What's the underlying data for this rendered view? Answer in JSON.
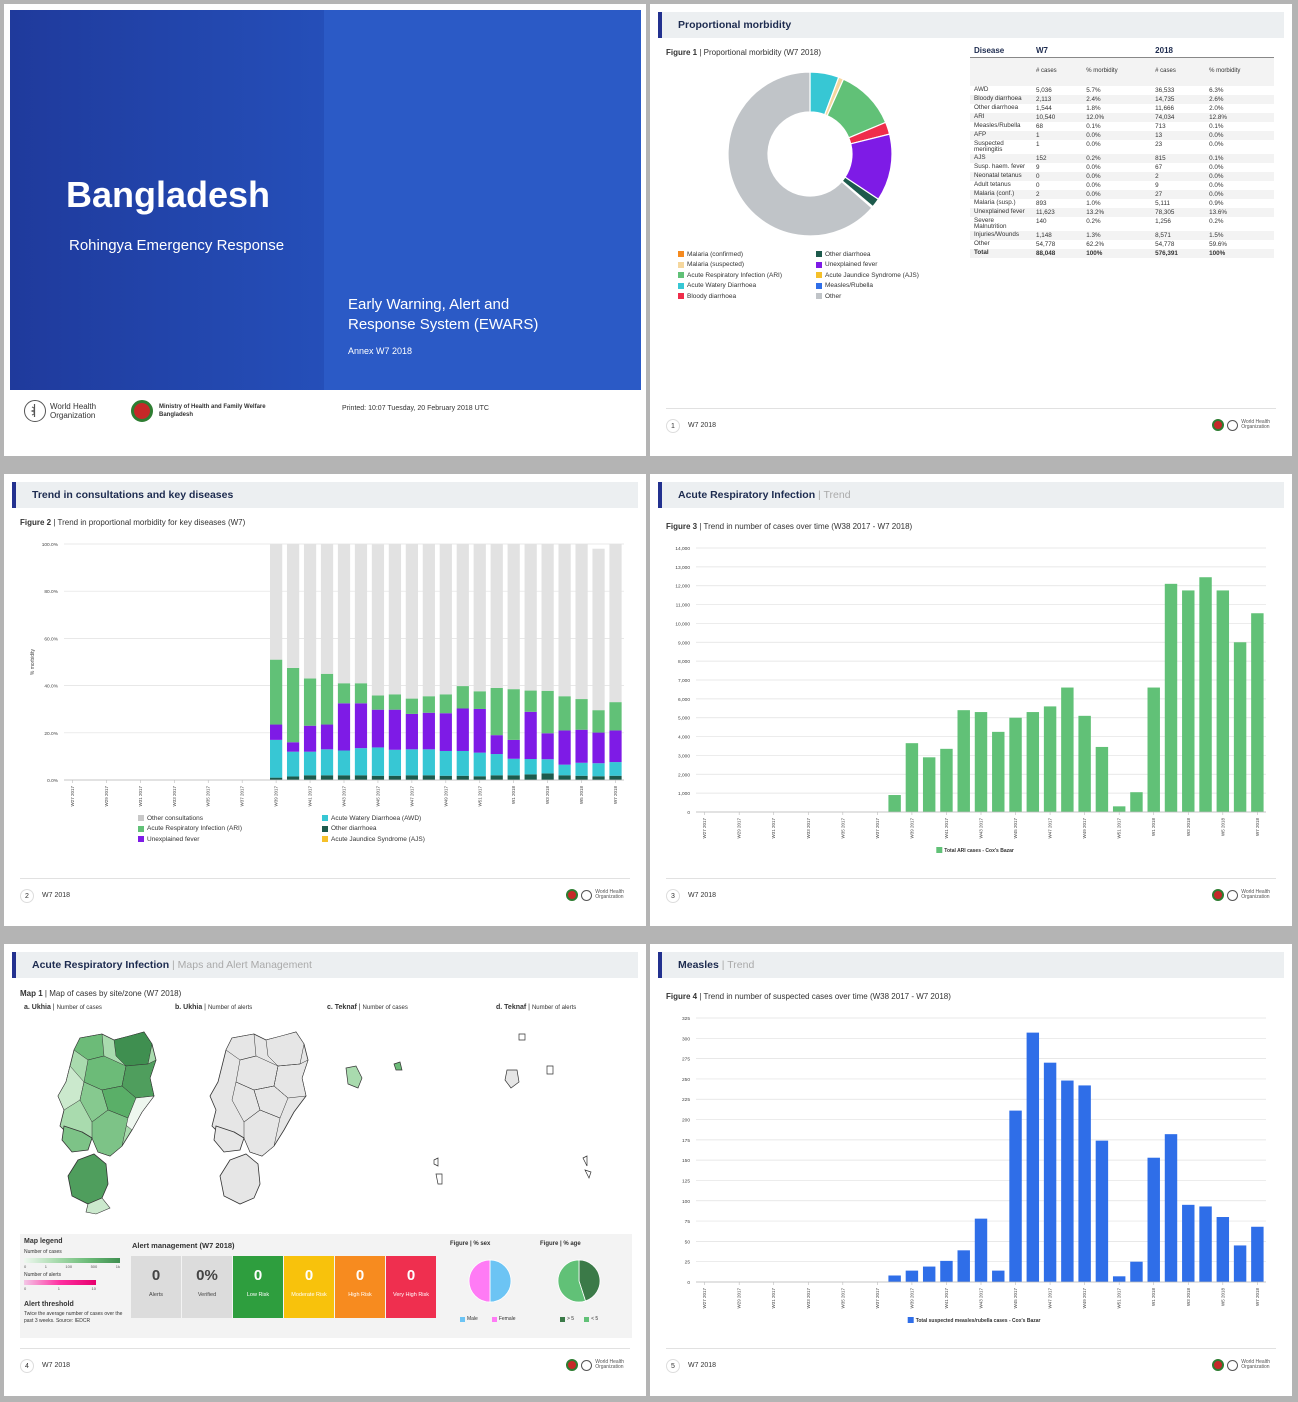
{
  "cover": {
    "country": "Bangladesh",
    "subtitle": "Rohingya Emergency Response",
    "system_line1": "Early Warning, Alert and",
    "system_line2": "Response System (EWARS)",
    "annex": "Annex W7 2018",
    "who_line1": "World Health",
    "who_line2": "Organization",
    "ministry_line1": "Ministry of Health and Family Welfare",
    "ministry_line2": "Bangladesh",
    "printed": "Printed: 10:07 Tuesday, 20 February 2018 UTC"
  },
  "footer": {
    "week": "W7 2018",
    "who_line1": "World Health",
    "who_line2": "Organization"
  },
  "page1": {
    "number": "1",
    "header": "Proportional morbidity",
    "fig_label": "Figure 1",
    "fig_caption": "Proportional morbidity (W7 2018)",
    "table": {
      "col_disease": "Disease",
      "col_w7": "W7",
      "col_2018": "2018",
      "sub_cases": "# cases",
      "sub_pct": "% morbidity",
      "rows": [
        [
          "AWD",
          "5,036",
          "5.7%",
          "36,533",
          "6.3%"
        ],
        [
          "Bloody diarrhoea",
          "2,113",
          "2.4%",
          "14,735",
          "2.6%"
        ],
        [
          "Other diarrhoea",
          "1,544",
          "1.8%",
          "11,666",
          "2.0%"
        ],
        [
          "ARI",
          "10,540",
          "12.0%",
          "74,034",
          "12.8%"
        ],
        [
          "Measles/Rubella",
          "68",
          "0.1%",
          "713",
          "0.1%"
        ],
        [
          "AFP",
          "1",
          "0.0%",
          "13",
          "0.0%"
        ],
        [
          "Suspected meningitis",
          "1",
          "0.0%",
          "23",
          "0.0%"
        ],
        [
          "AJS",
          "152",
          "0.2%",
          "815",
          "0.1%"
        ],
        [
          "Susp. haem. fever",
          "9",
          "0.0%",
          "67",
          "0.0%"
        ],
        [
          "Neonatal tetanus",
          "0",
          "0.0%",
          "2",
          "0.0%"
        ],
        [
          "Adult tetanus",
          "0",
          "0.0%",
          "9",
          "0.0%"
        ],
        [
          "Malaria (conf.)",
          "2",
          "0.0%",
          "27",
          "0.0%"
        ],
        [
          "Malaria (susp.)",
          "893",
          "1.0%",
          "5,111",
          "0.9%"
        ],
        [
          "Unexplained fever",
          "11,623",
          "13.2%",
          "78,305",
          "13.6%"
        ],
        [
          "Severe Malnutrition",
          "140",
          "0.2%",
          "1,256",
          "0.2%"
        ],
        [
          "Injuries/Wounds",
          "1,148",
          "1.3%",
          "8,571",
          "1.5%"
        ],
        [
          "Other",
          "54,778",
          "62.2%",
          "54,778",
          "59.6%"
        ],
        [
          "Total",
          "88,048",
          "100%",
          "576,391",
          "100%"
        ]
      ]
    },
    "legend": [
      {
        "label": "Malaria (confirmed)",
        "color": "#f58a1f"
      },
      {
        "label": "Other diarrhoea",
        "color": "#1d5a4c"
      },
      {
        "label": "Malaria (suspected)",
        "color": "#f5d79e"
      },
      {
        "label": "Unexplained fever",
        "color": "#7e1be6"
      },
      {
        "label": "Acute Respiratory Infection (ARI)",
        "color": "#61c177"
      },
      {
        "label": "Acute Jaundice Syndrome (AJS)",
        "color": "#f5c02a"
      },
      {
        "label": "Acute Watery Diarrhoea",
        "color": "#37c7d4"
      },
      {
        "label": "Measles/Rubella",
        "color": "#2f6ee8"
      },
      {
        "label": "Bloody diarrhoea",
        "color": "#ef2d4a"
      },
      {
        "label": "Other",
        "color": "#c0c4c8"
      }
    ]
  },
  "page2": {
    "number": "2",
    "header": "Trend in consultations and key diseases",
    "fig_label": "Figure 2",
    "fig_caption": "Trend in proportional morbidity for key diseases (W7)",
    "legend": [
      {
        "label": "Other consultations",
        "color": "#c8c8c8"
      },
      {
        "label": "Acute Watery Diarrhoea (AWD)",
        "color": "#37c7d4"
      },
      {
        "label": "Acute Respiratory Infection (ARI)",
        "color": "#61c177"
      },
      {
        "label": "Other diarrhoea",
        "color": "#1d5a4c"
      },
      {
        "label": "Unexplained fever",
        "color": "#7e1be6"
      },
      {
        "label": "Acute Jaundice Syndrome (AJS)",
        "color": "#f5c02a"
      }
    ]
  },
  "page3": {
    "number": "3",
    "header": "Acute Respiratory Infection",
    "header_sub": " | Trend",
    "fig_label": "Figure 3",
    "fig_caption": "Trend in number of cases over time (W38 2017 - W7 2018)",
    "legend": "Total ARI cases - Cox's Bazar"
  },
  "page4": {
    "number": "4",
    "header": "Acute Respiratory Infection",
    "header_sub": " | Maps and Alert Management",
    "map_label": "Map 1",
    "map_caption": "Map of cases by site/zone (W7 2018)",
    "maps": [
      {
        "title": "a. Ukhia",
        "sub": "Number of cases"
      },
      {
        "title": "b. Ukhia",
        "sub": "Number of alerts"
      },
      {
        "title": "c. Teknaf",
        "sub": "Number of cases"
      },
      {
        "title": "d. Teknaf",
        "sub": "Number of alerts"
      }
    ],
    "map_legend_title": "Map legend",
    "legend_cases": "Number of cases",
    "legend_alerts": "Number of alerts",
    "legend_cases_ticks": [
      "0",
      "1",
      "100",
      "500",
      "1k"
    ],
    "legend_alert_ticks": [
      "0",
      "1",
      "10"
    ],
    "threshold_title": "Alert threshold",
    "threshold_text": "Twice the average number of cases over the past 3 weeks. Source: IEDCR",
    "alert_title": "Alert management (W7 2018)",
    "alerts": [
      {
        "value": "0",
        "label": "Alerts",
        "bg": "#dcdcdc",
        "fg": "#444"
      },
      {
        "value": "0%",
        "label": "Verified",
        "bg": "#dcdcdc",
        "fg": "#444"
      },
      {
        "value": "0",
        "label": "Low Risk",
        "bg": "#2e9e3e",
        "fg": "#fff"
      },
      {
        "value": "0",
        "label": "Moderate Risk",
        "bg": "#f8c20c",
        "fg": "#fff"
      },
      {
        "value": "0",
        "label": "High Risk",
        "bg": "#f78b1f",
        "fg": "#fff"
      },
      {
        "value": "0",
        "label": "Very High Risk",
        "bg": "#ef2f4f",
        "fg": "#fff"
      }
    ],
    "sex_title": "Figure | % sex",
    "age_title": "Figure | % age",
    "sex_legend": [
      "Male",
      "Female"
    ],
    "age_legend": [
      "> 5",
      "< 5"
    ]
  },
  "page5": {
    "number": "5",
    "header": "Measles",
    "header_sub": " | Trend",
    "fig_label": "Figure 4",
    "fig_caption": "Trend in number of suspected cases over time (W38 2017 - W7 2018)",
    "legend": "Total suspected measles/rubella cases - Cox's Bazar"
  },
  "chart_data": [
    {
      "type": "pie",
      "title": "Proportional morbidity (W7 2018)",
      "categories": [
        "Acute Watery Diarrhoea",
        "Malaria (suspected)",
        "Malaria (confirmed)",
        "Acute Respiratory Infection (ARI)",
        "Bloody diarrhoea",
        "Unexplained fever",
        "Other diarrhoea",
        "Acute Jaundice Syndrome (AJS)",
        "Measles/Rubella",
        "Other"
      ],
      "values": [
        5.7,
        1.0,
        0.0,
        12.0,
        2.4,
        13.2,
        1.8,
        0.2,
        0.1,
        63.6
      ],
      "colors": [
        "#37c7d4",
        "#f5d79e",
        "#f58a1f",
        "#61c177",
        "#ef2d4a",
        "#7e1be6",
        "#1d5a4c",
        "#f5c02a",
        "#2f6ee8",
        "#c0c4c8"
      ]
    },
    {
      "type": "bar",
      "title": "Trend in proportional morbidity for key diseases (W7)",
      "ylabel": "% morbidity",
      "ylim": [
        0,
        100
      ],
      "yticks": [
        "0.0%",
        "20.0%",
        "40.0%",
        "60.0%",
        "80.0%",
        "100.0%"
      ],
      "categories": [
        "W27 2017",
        "W28 2017",
        "W29 2017",
        "W30 2017",
        "W31 2017",
        "W32 2017",
        "W33 2017",
        "W34 2017",
        "W35 2017",
        "W36 2017",
        "W37 2017",
        "W38 2017",
        "W39 2017",
        "W40 2017",
        "W41 2017",
        "W42 2017",
        "W43 2017",
        "W44 2017",
        "W45 2017",
        "W46 2017",
        "W47 2017",
        "W48 2017",
        "W49 2017",
        "W50 2017",
        "W51 2017",
        "W52 2017",
        "W1 2018",
        "W2 2018",
        "W3 2018",
        "W4 2018",
        "W5 2018",
        "W6 2018",
        "W7 2018"
      ],
      "tick_labels": [
        "W27 2017",
        "W29 2017",
        "W31 2017",
        "W33 2017",
        "W35 2017",
        "W37 2017",
        "W39 2017",
        "W41 2017",
        "W43 2017",
        "W45 2017",
        "W47 2017",
        "W49 2017",
        "W51 2017",
        "W1 2018",
        "W3 2018",
        "W5 2018",
        "W7 2018"
      ],
      "series": [
        {
          "name": "Other diarrhoea",
          "color": "#1d5a4c",
          "values": [
            0,
            0,
            0,
            0,
            0,
            0,
            0,
            0,
            0,
            0,
            0,
            0,
            1.0,
            1.5,
            2.0,
            2.0,
            2.0,
            2.0,
            1.8,
            1.8,
            2.0,
            2.0,
            1.8,
            1.8,
            1.6,
            2.0,
            2.0,
            2.4,
            2.8,
            2.0,
            1.8,
            1.6,
            1.8
          ]
        },
        {
          "name": "Acute Watery Diarrhoea (AWD)",
          "color": "#37c7d4",
          "values": [
            0,
            0,
            0,
            0,
            0,
            0,
            0,
            0,
            0,
            0,
            0,
            0,
            16.0,
            10.5,
            10.0,
            11.0,
            10.5,
            11.5,
            12.0,
            11.0,
            11.0,
            11.0,
            10.5,
            10.5,
            10.0,
            9.0,
            7.0,
            6.5,
            6.0,
            4.5,
            5.5,
            5.5,
            5.8
          ]
        },
        {
          "name": "Unexplained fever",
          "color": "#7e1be6",
          "values": [
            0,
            0,
            0,
            0,
            0,
            0,
            0,
            0,
            0,
            0,
            0,
            0,
            6.5,
            4.0,
            11.0,
            10.5,
            20.0,
            19.0,
            16.0,
            17.0,
            15.0,
            15.5,
            16.0,
            18.0,
            18.5,
            8.0,
            8.0,
            20.0,
            11.0,
            14.5,
            14.0,
            13.0,
            13.4
          ]
        },
        {
          "name": "Acute Respiratory Infection (ARI)",
          "color": "#61c177",
          "values": [
            0,
            0,
            0,
            0,
            0,
            0,
            0,
            0,
            0,
            0,
            0,
            0,
            27.5,
            31.5,
            20.0,
            21.5,
            8.5,
            8.5,
            6.0,
            6.5,
            6.5,
            7.0,
            8.0,
            9.5,
            7.5,
            20.0,
            21.5,
            9.0,
            18.0,
            14.5,
            13.0,
            9.5,
            12.0
          ]
        },
        {
          "name": "Other consultations",
          "color": "#e2e2e2",
          "values": [
            0,
            0,
            0,
            0,
            0,
            0,
            0,
            0,
            0,
            0,
            0,
            0,
            49,
            52.5,
            57,
            55,
            59,
            59,
            64,
            63.7,
            65.5,
            64.5,
            63.7,
            60.2,
            62.4,
            61,
            61.5,
            62.1,
            62.2,
            64.5,
            65.7,
            68.4,
            67
          ]
        },
        {
          "name": "Acute Jaundice Syndrome (AJS)",
          "color": "#f5c02a",
          "values": []
        }
      ]
    },
    {
      "type": "bar",
      "title": "Trend in number of cases over time (W38 2017 - W7 2018)",
      "ylim": [
        0,
        14000
      ],
      "yticks": [
        "0",
        "1,000",
        "2,000",
        "3,000",
        "4,000",
        "5,000",
        "6,000",
        "7,000",
        "8,000",
        "9,000",
        "10,000",
        "11,000",
        "12,000",
        "13,000",
        "14,000"
      ],
      "categories": [
        "W27 2017",
        "W28 2017",
        "W29 2017",
        "W30 2017",
        "W31 2017",
        "W32 2017",
        "W33 2017",
        "W34 2017",
        "W35 2017",
        "W36 2017",
        "W37 2017",
        "W38 2017",
        "W39 2017",
        "W40 2017",
        "W41 2017",
        "W42 2017",
        "W43 2017",
        "W44 2017",
        "W45 2017",
        "W46 2017",
        "W47 2017",
        "W48 2017",
        "W49 2017",
        "W50 2017",
        "W51 2017",
        "W52 2017",
        "W1 2018",
        "W2 2018",
        "W3 2018",
        "W4 2018",
        "W5 2018",
        "W6 2018",
        "W7 2018"
      ],
      "tick_labels": [
        "W27 2017",
        "W29 2017",
        "W31 2017",
        "W33 2017",
        "W35 2017",
        "W37 2017",
        "W39 2017",
        "W41 2017",
        "W43 2017",
        "W45 2017",
        "W47 2017",
        "W49 2017",
        "W51 2017",
        "W1 2018",
        "W3 2018",
        "W5 2018",
        "W7 2018"
      ],
      "series": [
        {
          "name": "Total ARI cases - Cox's Bazar",
          "color": "#61c177",
          "values": [
            0,
            0,
            0,
            0,
            0,
            0,
            0,
            0,
            0,
            0,
            0,
            900,
            3650,
            2900,
            3350,
            5400,
            5300,
            4250,
            5000,
            5300,
            5600,
            6600,
            5100,
            3450,
            300,
            1050,
            6600,
            12100,
            11750,
            12450,
            11750,
            9000,
            10540
          ]
        }
      ]
    },
    {
      "type": "bar",
      "title": "Trend in number of suspected cases over time (W38 2017 - W7 2018)",
      "ylim": [
        0,
        325
      ],
      "yticks": [
        "0",
        "25",
        "50",
        "75",
        "100",
        "125",
        "150",
        "175",
        "200",
        "225",
        "250",
        "275",
        "300",
        "325"
      ],
      "categories": [
        "W27 2017",
        "W28 2017",
        "W29 2017",
        "W30 2017",
        "W31 2017",
        "W32 2017",
        "W33 2017",
        "W34 2017",
        "W35 2017",
        "W36 2017",
        "W37 2017",
        "W38 2017",
        "W39 2017",
        "W40 2017",
        "W41 2017",
        "W42 2017",
        "W43 2017",
        "W44 2017",
        "W45 2017",
        "W46 2017",
        "W47 2017",
        "W48 2017",
        "W49 2017",
        "W50 2017",
        "W51 2017",
        "W52 2017",
        "W1 2018",
        "W2 2018",
        "W3 2018",
        "W4 2018",
        "W5 2018",
        "W6 2018",
        "W7 2018"
      ],
      "tick_labels": [
        "W27 2017",
        "W29 2017",
        "W31 2017",
        "W33 2017",
        "W35 2017",
        "W37 2017",
        "W39 2017",
        "W41 2017",
        "W43 2017",
        "W45 2017",
        "W47 2017",
        "W49 2017",
        "W51 2017",
        "W1 2018",
        "W3 2018",
        "W5 2018",
        "W7 2018"
      ],
      "series": [
        {
          "name": "Total suspected measles/rubella cases - Cox's Bazar",
          "color": "#2f6ee8",
          "values": [
            0,
            0,
            0,
            0,
            0,
            0,
            0,
            0,
            0,
            0,
            0,
            8,
            14,
            19,
            26,
            39,
            78,
            14,
            211,
            307,
            270,
            248,
            242,
            174,
            7,
            25,
            153,
            182,
            95,
            93,
            80,
            45,
            68
          ]
        }
      ]
    },
    {
      "type": "pie",
      "title": "% sex",
      "categories": [
        "Male",
        "Female"
      ],
      "values": [
        50,
        50
      ],
      "colors": [
        "#6cc4f4",
        "#ff7bf5"
      ]
    },
    {
      "type": "pie",
      "title": "% age",
      "categories": [
        "> 5",
        "< 5"
      ],
      "values": [
        45,
        55
      ],
      "colors": [
        "#3b7a48",
        "#61c177"
      ]
    }
  ]
}
